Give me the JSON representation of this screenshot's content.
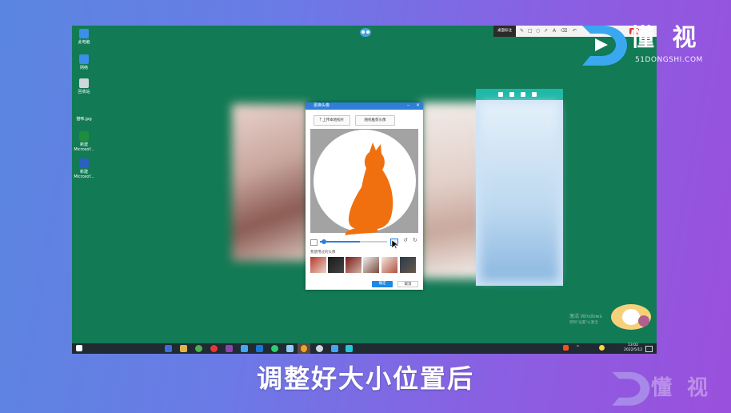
{
  "desktop": {
    "icons": [
      {
        "label": "此电脑",
        "color": "#3b8fe6"
      },
      {
        "label": "网络",
        "color": "#3b8fe6"
      },
      {
        "label": "回收站",
        "color": "#cfd8dc"
      },
      {
        "label": "猫咪.jpg",
        "color": "#127a55"
      },
      {
        "label": "新建 Microsof...",
        "color": "#1e8e3e"
      },
      {
        "label": "新建 Microsof...",
        "color": "#2b5fc1"
      }
    ],
    "watermark_line1": "激活 Windows",
    "watermark_line2": "转到\"设置\"以激活"
  },
  "toolbar": {
    "label": "桌面标注",
    "tools": [
      "✎",
      "□",
      "○",
      "↗",
      "A",
      "⌫",
      "↶"
    ]
  },
  "dialog": {
    "title": "更换头像",
    "upload_label": "上传本地照片",
    "recommend_label": "随机推荐头像",
    "history_label": "我使用过的头像",
    "confirm_label": "确定",
    "cancel_label": "取消",
    "cat_color": "#f07010",
    "zoom_percent": 60
  },
  "taskbar": {
    "time": "13:02",
    "date": "2022/5/12"
  },
  "brand": {
    "name": "懂 视",
    "domain": "51DONGSHI.COM"
  },
  "caption": "调整好大小位置后"
}
